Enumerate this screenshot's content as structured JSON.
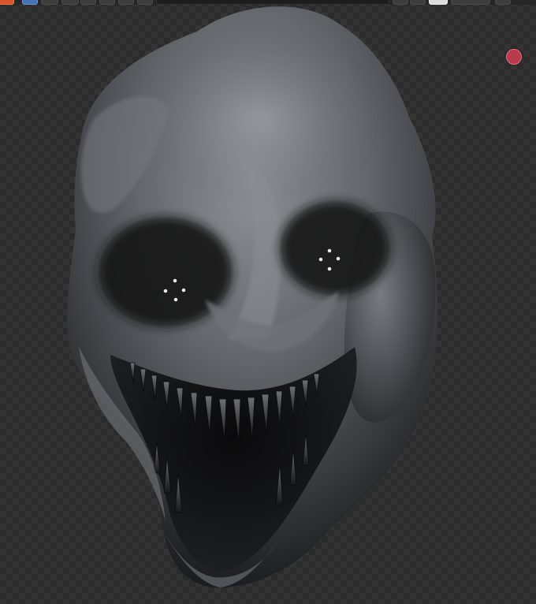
{
  "window": {
    "type": "3d-viewport",
    "background": "transparent-checkerboard"
  },
  "toolbar": {
    "buttons": [
      "editor-type-icon",
      "select-box-icon",
      "tweak-icon",
      "mode-toggle-icon",
      "transform-icon",
      "view-icon",
      "overlay-icon",
      "shading-icon"
    ]
  },
  "viewport": {
    "subject": "creature-head-sculpt",
    "colors": {
      "skin_light": "#8a8d92",
      "skin_mid": "#56595e",
      "skin_dark": "#1a1b1e",
      "record_indicator": "#b93a4c"
    }
  }
}
